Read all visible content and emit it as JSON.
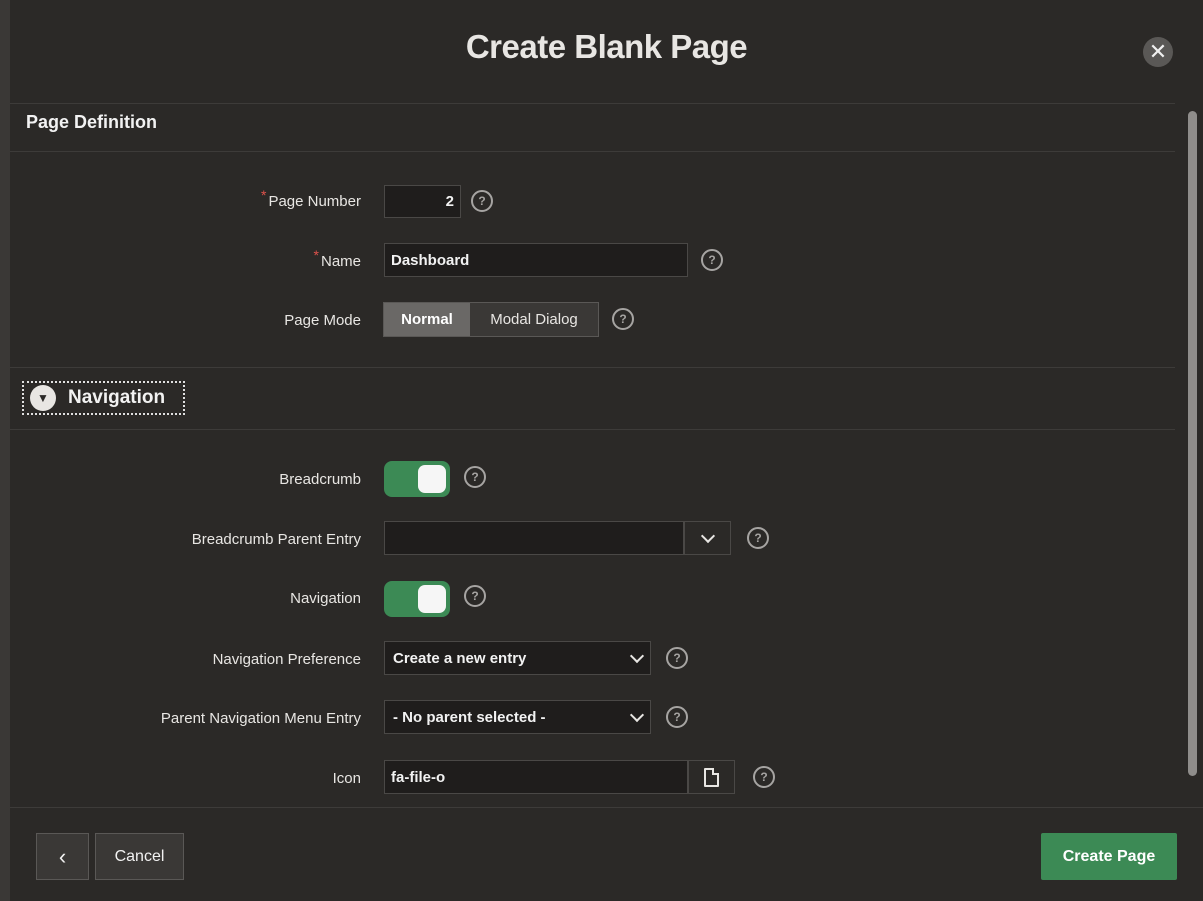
{
  "dialog": {
    "title": "Create Blank Page",
    "close_glyph": "✕"
  },
  "page_definition": {
    "section_title": "Page Definition",
    "required_marker": "*",
    "page_number": {
      "label": "Page Number",
      "value": "2"
    },
    "name": {
      "label": "Name",
      "value": "Dashboard"
    },
    "page_mode": {
      "label": "Page Mode",
      "options": [
        "Normal",
        "Modal Dialog"
      ],
      "selected": "Normal"
    }
  },
  "navigation": {
    "section_title": "Navigation",
    "breadcrumb": {
      "label": "Breadcrumb",
      "on": true
    },
    "breadcrumb_parent_entry": {
      "label": "Breadcrumb Parent Entry",
      "value": ""
    },
    "navigation_toggle": {
      "label": "Navigation",
      "on": true
    },
    "navigation_preference": {
      "label": "Navigation Preference",
      "value": "Create a new entry"
    },
    "parent_navigation_menu_entry": {
      "label": "Parent Navigation Menu Entry",
      "value": "- No parent selected -"
    },
    "icon": {
      "label": "Icon",
      "value": "fa-file-o"
    }
  },
  "help_glyph": "?",
  "footer": {
    "back_glyph": "‹",
    "cancel_label": "Cancel",
    "create_label": "Create Page"
  },
  "colors": {
    "accent_green": "#3c8a55",
    "required_red": "#e0524c",
    "background": "#2b2927"
  }
}
